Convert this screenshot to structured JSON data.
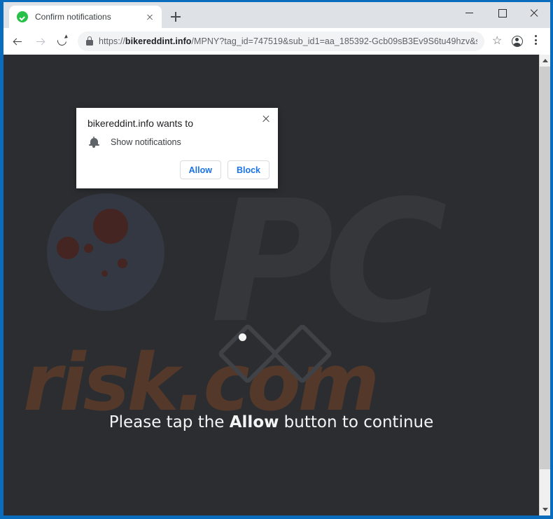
{
  "browser": {
    "tab": {
      "title": "Confirm notifications",
      "favicon": "green-check-circle-icon",
      "close_icon": "close-icon"
    },
    "new_tab_icon": "plus-icon",
    "window_controls": {
      "minimize": "minimize-icon",
      "maximize": "maximize-icon",
      "close": "close-icon"
    },
    "toolbar": {
      "back_icon": "back-arrow-icon",
      "forward_icon": "forward-arrow-icon",
      "reload_icon": "reload-icon",
      "lock_icon": "lock-icon",
      "bookmark_icon": "star-icon",
      "profile_icon": "account-avatar-icon",
      "menu_icon": "three-dot-menu-icon",
      "star_glyph": "☆"
    },
    "omnibox": {
      "scheme": "https://",
      "domain": "bikereddint.info",
      "path": "/MPNY?tag_id=747519&sub_id1=aa_185392-Gcb09sB3Ev9S6tu49hzv&s...",
      "full_url": "https://bikereddint.info/MPNY?tag_id=747519&sub_id1=aa_185392-Gcb09sB3Ev9S6tu49hzv&s..."
    },
    "scrollbar": {
      "up_icon": "scroll-up-arrow-icon",
      "down_icon": "scroll-down-arrow-icon"
    }
  },
  "permission_dialog": {
    "title": "bikereddint.info wants to",
    "request_icon": "bell-icon",
    "request_label": "Show notifications",
    "allow_label": "Allow",
    "block_label": "Block",
    "close_icon": "close-icon"
  },
  "page": {
    "message_prefix": "Please tap the ",
    "message_emphasis": "Allow",
    "message_suffix": " button to continue",
    "loader_icon": "double-diamond-spinner-icon",
    "watermark": {
      "brand": "PC",
      "suffix": "risk.com",
      "glass_icon": "magnifying-glass-germs-icon"
    }
  },
  "colors": {
    "window_frame": "#0a6cbd",
    "tabstrip": "#dee1e6",
    "page_background": "#2b2d31",
    "accent_link": "#1a73e8",
    "favicon_green": "#27c048",
    "watermark_gray": "#35373b",
    "watermark_brown": "#54382a"
  }
}
